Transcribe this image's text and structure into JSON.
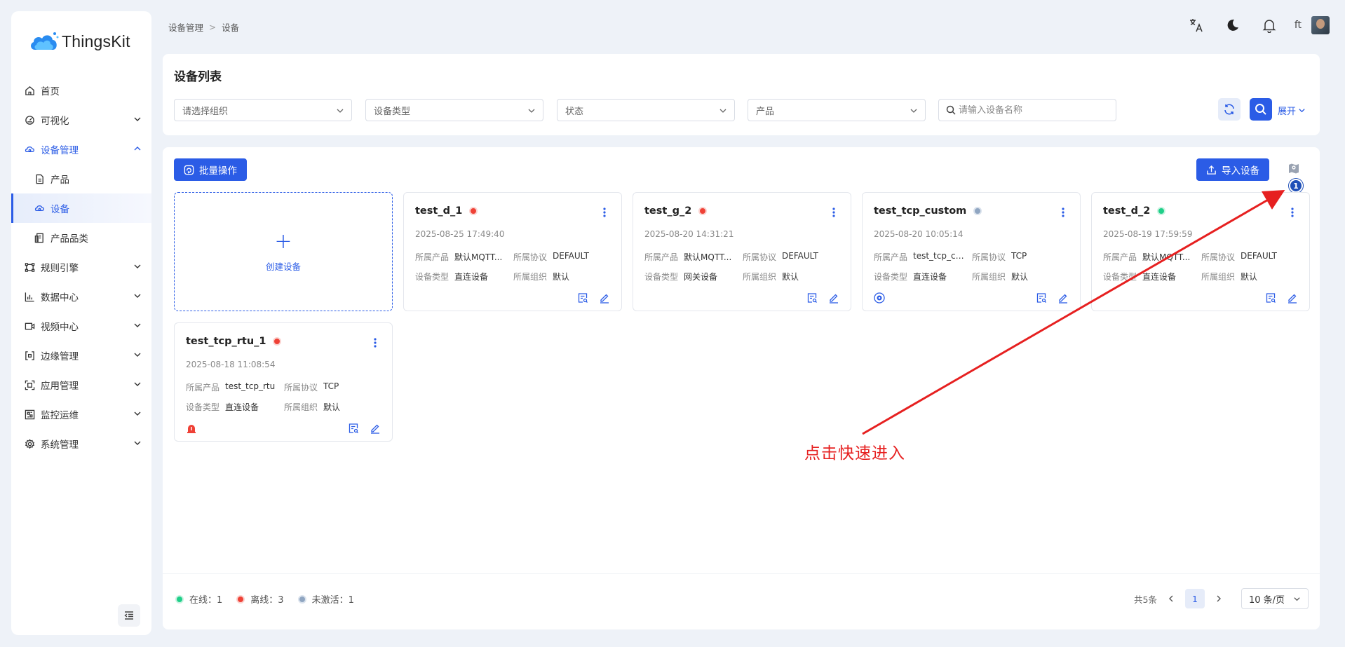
{
  "app": {
    "logo_text": "ThingsKit"
  },
  "sidebar": {
    "items": [
      {
        "label": "首页",
        "icon": "home-icon"
      },
      {
        "label": "可视化",
        "icon": "dashboard-icon"
      },
      {
        "label": "设备管理",
        "icon": "device-icon"
      },
      {
        "label": "产品",
        "icon": "product-icon"
      },
      {
        "label": "设备",
        "icon": "device-icon"
      },
      {
        "label": "产品品类",
        "icon": "category-icon"
      },
      {
        "label": "规则引擎",
        "icon": "rule-icon"
      },
      {
        "label": "数据中心",
        "icon": "chart-icon"
      },
      {
        "label": "视频中心",
        "icon": "video-icon"
      },
      {
        "label": "边缘管理",
        "icon": "edge-icon"
      },
      {
        "label": "应用管理",
        "icon": "app-icon"
      },
      {
        "label": "监控运维",
        "icon": "monitor-icon"
      },
      {
        "label": "系统管理",
        "icon": "gear-icon"
      }
    ]
  },
  "header": {
    "breadcrumb": [
      "设备管理",
      "设备"
    ],
    "user_name": "ft"
  },
  "filter": {
    "title": "设备列表",
    "org_placeholder": "请选择组织",
    "type_placeholder": "设备类型",
    "status_placeholder": "状态",
    "product_placeholder": "产品",
    "search_placeholder": "请输入设备名称",
    "expand_label": "展开"
  },
  "toolbar": {
    "batch_label": "批量操作",
    "import_label": "导入设备",
    "map_badge": "1"
  },
  "create_card": {
    "label": "创建设备"
  },
  "devices": [
    {
      "name": "test_d_1",
      "status": "offline",
      "time": "2025-08-25 17:49:40",
      "k_product": "所属产品",
      "product": "默认MQTT...",
      "k_protocol": "所属协议",
      "protocol": "DEFAULT",
      "k_type": "设备类型",
      "type": "直连设备",
      "k_org": "所属组织",
      "org": "默认"
    },
    {
      "name": "test_g_2",
      "status": "offline",
      "time": "2025-08-20 14:31:21",
      "k_product": "所属产品",
      "product": "默认MQTT...",
      "k_protocol": "所属协议",
      "protocol": "DEFAULT",
      "k_type": "设备类型",
      "type": "网关设备",
      "k_org": "所属组织",
      "org": "默认"
    },
    {
      "name": "test_tcp_custom",
      "status": "inactive",
      "time": "2025-08-20 10:05:14",
      "k_product": "所属产品",
      "product": "test_tcp_cu...",
      "k_protocol": "所属协议",
      "protocol": "TCP",
      "k_type": "设备类型",
      "type": "直连设备",
      "k_org": "所属组织",
      "org": "默认"
    },
    {
      "name": "test_d_2",
      "status": "online",
      "time": "2025-08-19 17:59:59",
      "k_product": "所属产品",
      "product": "默认MQTT...",
      "k_protocol": "所属协议",
      "protocol": "DEFAULT",
      "k_type": "设备类型",
      "type": "直连设备",
      "k_org": "所属组织",
      "org": "默认"
    },
    {
      "name": "test_tcp_rtu_1",
      "status": "offline",
      "time": "2025-08-18 11:08:54",
      "k_product": "所属产品",
      "product": "test_tcp_rtu",
      "k_protocol": "所属协议",
      "protocol": "TCP",
      "k_type": "设备类型",
      "type": "直连设备",
      "k_org": "所属组织",
      "org": "默认"
    }
  ],
  "legend": {
    "online": "在线：1",
    "offline": "离线：3",
    "inactive": "未激活：1"
  },
  "pagination": {
    "total": "共5条",
    "current_page": "1",
    "page_size": "10 条/页"
  },
  "annotation": {
    "text": "点击快速进入"
  },
  "colors": {
    "primary": "#2b5ce6",
    "online": "#1fcf89",
    "offline": "#ef4136",
    "inactive": "#8fa5c1",
    "annotation": "#e62020"
  }
}
